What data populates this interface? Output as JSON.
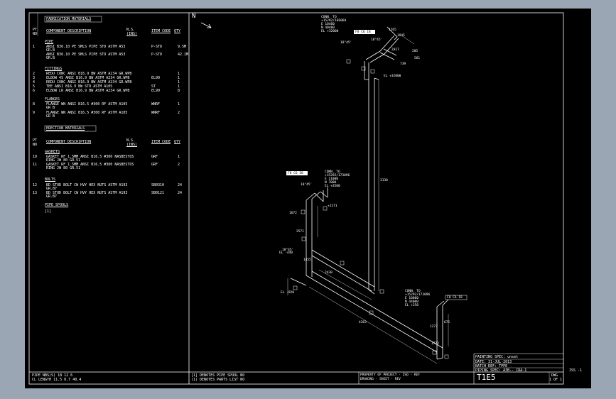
{
  "bom": {
    "header_pt": "PT",
    "header_no": "NO",
    "fabrication_title": "FABRICATION MATERIALS",
    "col_description": "COMPONENT DESCRIPTION",
    "col_ns_1": "N.S.",
    "col_ns_2": "(INS)",
    "col_item_code": "ITEM CODE",
    "col_qty": "QTY",
    "pipe_title": "PIPE",
    "pipe_rows": [
      {
        "no": "1",
        "desc": "ANSI B36.10 PE SMLS PIPE STD ASTM A53",
        "desc2": "GR.B",
        "code": "P-STD",
        "qty": "9.5M"
      },
      {
        "no": "",
        "desc": "ANSI B36.10 PE SMLS PIPE STD ASTM A53",
        "desc2": "GR.B",
        "code": "P-STD",
        "qty": "42.1M"
      }
    ],
    "fittings_title": "FITTINGS",
    "fitting_rows": [
      {
        "no": "2",
        "desc": "REDU CONC ANSI B16.9 BW ASTM A234 GR.WPB",
        "code": "",
        "qty": "1"
      },
      {
        "no": "3",
        "desc": "ELBOW 45 ANSI B16.9 BW ASTM A234 GR.WPB",
        "code": "EL90",
        "qty": "1"
      },
      {
        "no": "4",
        "desc": "REDU CONC ANSI B16.9 BW ASTM A234 GR.WPB",
        "code": "",
        "qty": "1"
      },
      {
        "no": "5",
        "desc": "TEE ANSI B16.9 BW STD ASTM A105",
        "code": "ST",
        "qty": "1"
      },
      {
        "no": "6",
        "desc": "ELBOW LR ANSI B16.9 BW ASTM A234 GR.WPB",
        "code": "EL90",
        "qty": "8"
      }
    ],
    "flanges_title": "FLANGES",
    "flange_rows": [
      {
        "no": "8",
        "desc": "FLANGE WN ANSI B16.5 #300 RF ASTM A105",
        "desc2": "GR B",
        "code": "WNRF",
        "qty": "1"
      },
      {
        "no": "9",
        "desc": "FLANGE WN ANSI B16.5 #300 RF ASTM A105",
        "desc2": "GR B",
        "code": "WNRF",
        "qty": "2"
      }
    ],
    "erection_title": "ERECTION MATERIALS",
    "gaskets_title": "GASKETS",
    "gasket_rows": [
      {
        "no": "10",
        "desc": "GASKET RF 1.5MM ANSI B16.5 #300 NASBESTOS",
        "desc2": "RING JW 80 GR.51",
        "code": "GRF",
        "qty": "1"
      },
      {
        "no": "11",
        "desc": "GASKET RF 1.5MM ANSI B16.5 #300 NASBESTOS",
        "desc2": "RING JW 80 GR.51",
        "code": "GRF",
        "qty": "2"
      }
    ],
    "bolts_title": "BOLTS",
    "bolt_rows": [
      {
        "no": "12",
        "desc": "BD STUD BOLT CW HVY HEX NUTS ASTM A193",
        "desc2": "GR.B7",
        "code": "SB0310",
        "qty": "24"
      },
      {
        "no": "13",
        "desc": "BD STUD BOLT CW HVY HEX NUTS ASTM A193",
        "desc2": "GR.B7",
        "code": "SB0121",
        "qty": "24"
      }
    ],
    "spools_title": "PIPE SPOOLS",
    "spool_marker": "[1]"
  },
  "footer": {
    "pipe_nbs": "PIPE NBS(S) 18 12 6",
    "cl_length": "CL LENGTH 11.5 0.7 40.4",
    "note_spool": "[1] DENOTES PIPE SPOOL NO",
    "note_parts": "(1) DENOTES PARTS LIST NO",
    "title_strip_1": "PROPERTY OF PROJECT · ISO · REF",
    "title_strip_2": "DRAWING · SHEET · REV",
    "drawing_no": "T1E5"
  },
  "title_block": {
    "painting": "PAINTING SPEC: unset",
    "date": "DATE: 31-JUL-2013",
    "batch": "BATCH REF: TPPE",
    "piping_spec": "PIPING SPEC: A3B-- IRA-1",
    "dwg_label": "DWG",
    "sheet": "1 OF 1",
    "iss": "ISS -1"
  },
  "iso": {
    "north": "N",
    "conn_top": [
      "CONN. TO",
      "+15292/166068",
      "E 10460",
      "N 40400",
      "EL +32000"
    ],
    "conn_mid": [
      "CONN. TO",
      "+15292/173096",
      "E 11000",
      "N 7000",
      "EL +3500"
    ],
    "conn_bot": [
      "CONN. TO",
      "+15292/173096",
      "E 10800",
      "N 44000",
      "EL +250"
    ],
    "tag_top": "F8 C6 I8",
    "tag_mid": "F8 C6 I8",
    "tag_bot": "F8 C6 I8",
    "dims": [
      "1765",
      "1845",
      "2017",
      "205",
      "561",
      "739",
      "3130",
      "1672",
      "2571",
      "1455",
      "2430",
      "1277",
      "4363",
      "1772",
      "675"
    ],
    "elevs": [
      "EL +32000",
      "+2171",
      "EL -440",
      "EL -920"
    ],
    "bends": [
      "18\"45'",
      "18\"45'",
      "18\"45'",
      "18\"45'"
    ]
  }
}
